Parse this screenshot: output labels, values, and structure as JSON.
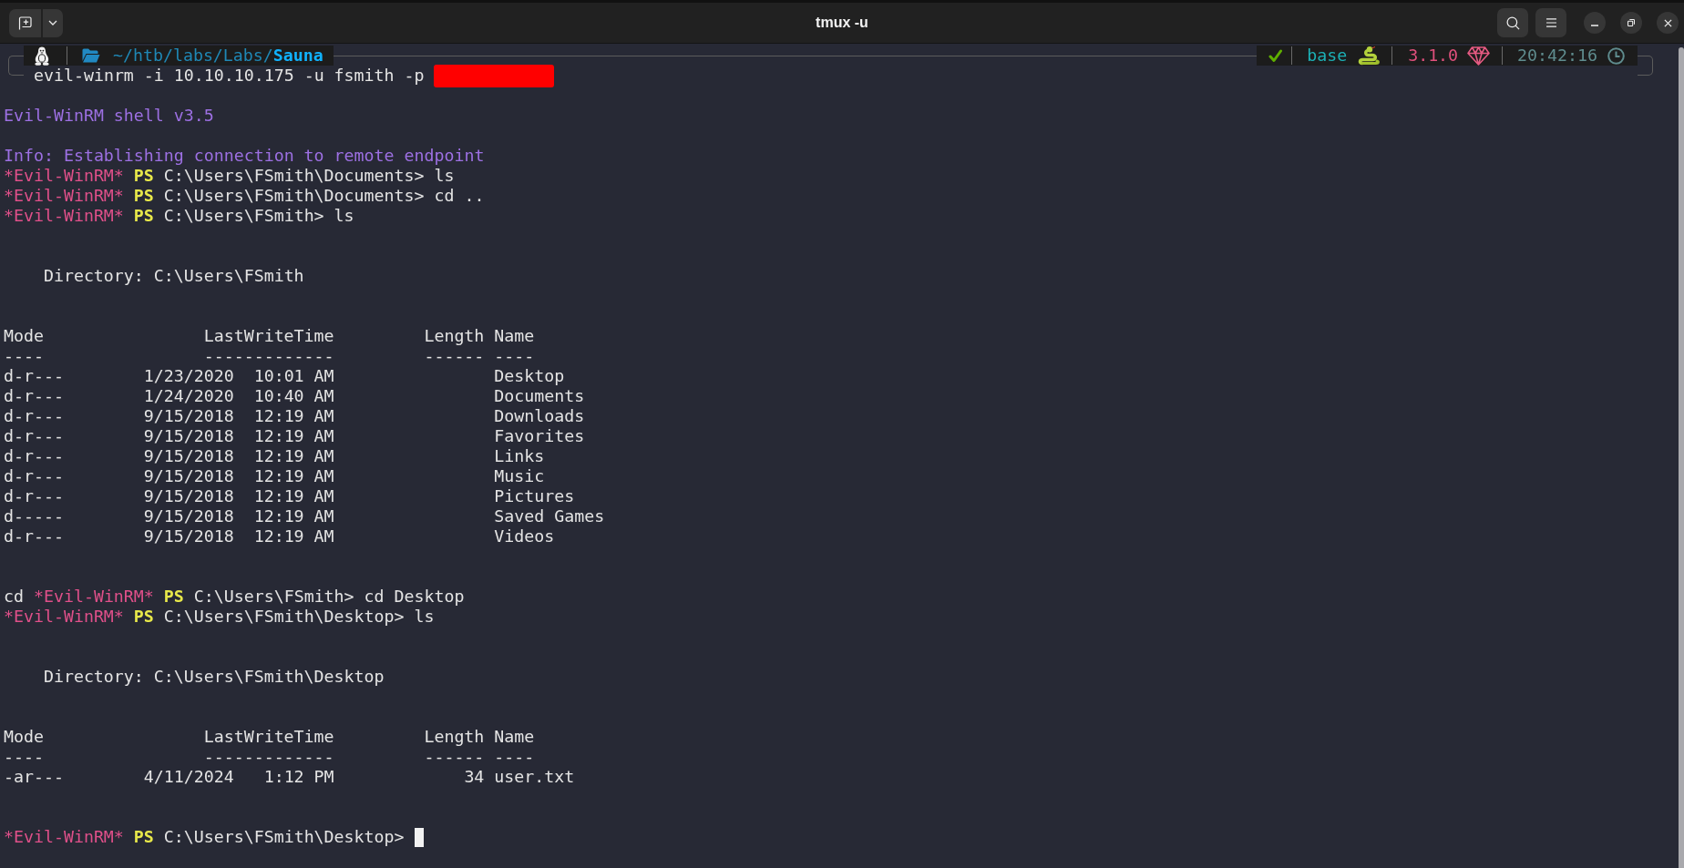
{
  "window": {
    "title": "tmux -u"
  },
  "prompt_bar": {
    "path_prefix": "~/htb/labs/Labs/",
    "path_current": "Sauna",
    "environment": "base",
    "ruby_version": "3.1.0",
    "time": "20:42:16"
  },
  "command_line": {
    "text": "evil-winrm -i 10.10.10.175 -u fsmith -p",
    "redacted": true
  },
  "output": [
    {
      "kind": "blank"
    },
    {
      "kind": "banner",
      "text": "Evil-WinRM shell v3.5"
    },
    {
      "kind": "blank"
    },
    {
      "kind": "info",
      "text": "Info: Establishing connection to remote endpoint"
    },
    {
      "kind": "prompt",
      "label": "*Evil-WinRM*",
      "shell": "PS",
      "path": "C:\\Users\\FSmith\\Documents>",
      "command": "ls",
      "cursor": false
    },
    {
      "kind": "prompt",
      "label": "*Evil-WinRM*",
      "shell": "PS",
      "path": "C:\\Users\\FSmith\\Documents>",
      "command": "cd ..",
      "cursor": false
    },
    {
      "kind": "prompt",
      "label": "*Evil-WinRM*",
      "shell": "PS",
      "path": "C:\\Users\\FSmith>",
      "command": "ls",
      "cursor": false
    },
    {
      "kind": "blank"
    },
    {
      "kind": "blank"
    },
    {
      "kind": "heading",
      "text": "Directory: C:\\Users\\FSmith"
    },
    {
      "kind": "blank"
    },
    {
      "kind": "blank"
    },
    {
      "kind": "table",
      "columns": [
        {
          "header": "Mode",
          "rule": "----"
        },
        {
          "header": "LastWriteTime",
          "rule": "-------------"
        },
        {
          "header": "Length",
          "rule": "------"
        },
        {
          "header": "Name",
          "rule": "----"
        }
      ],
      "rows": [
        {
          "mode": "d-r---",
          "last_write_time": "1/23/2020  10:01 AM",
          "name": "Desktop"
        },
        {
          "mode": "d-r---",
          "last_write_time": "1/24/2020  10:40 AM",
          "name": "Documents"
        },
        {
          "mode": "d-r---",
          "last_write_time": "9/15/2018  12:19 AM",
          "name": "Downloads"
        },
        {
          "mode": "d-r---",
          "last_write_time": "9/15/2018  12:19 AM",
          "name": "Favorites"
        },
        {
          "mode": "d-r---",
          "last_write_time": "9/15/2018  12:19 AM",
          "name": "Links"
        },
        {
          "mode": "d-r---",
          "last_write_time": "9/15/2018  12:19 AM",
          "name": "Music"
        },
        {
          "mode": "d-r---",
          "last_write_time": "9/15/2018  12:19 AM",
          "name": "Pictures"
        },
        {
          "mode": "d-----",
          "last_write_time": "9/15/2018  12:19 AM",
          "name": "Saved Games"
        },
        {
          "mode": "d-r---",
          "last_write_time": "9/15/2018  12:19 AM",
          "name": "Videos"
        }
      ]
    },
    {
      "kind": "blank"
    },
    {
      "kind": "blank"
    },
    {
      "kind": "prompt",
      "prefix": "cd",
      "label": "*Evil-WinRM*",
      "shell": "PS",
      "path": "C:\\Users\\FSmith>",
      "command": "cd Desktop",
      "cursor": false
    },
    {
      "kind": "prompt",
      "label": "*Evil-WinRM*",
      "shell": "PS",
      "path": "C:\\Users\\FSmith\\Desktop>",
      "command": "ls",
      "cursor": false
    },
    {
      "kind": "blank"
    },
    {
      "kind": "blank"
    },
    {
      "kind": "heading",
      "text": "Directory: C:\\Users\\FSmith\\Desktop"
    },
    {
      "kind": "blank"
    },
    {
      "kind": "blank"
    },
    {
      "kind": "table",
      "columns": [
        {
          "header": "Mode",
          "rule": "----"
        },
        {
          "header": "LastWriteTime",
          "rule": "-------------"
        },
        {
          "header": "Length",
          "rule": "------"
        },
        {
          "header": "Name",
          "rule": "----"
        }
      ],
      "rows": [
        {
          "mode": "-ar---",
          "last_write_time": "4/11/2024   1:12 PM",
          "length": "34",
          "name": "user.txt"
        }
      ]
    },
    {
      "kind": "blank"
    },
    {
      "kind": "blank"
    },
    {
      "kind": "prompt",
      "label": "*Evil-WinRM*",
      "shell": "PS",
      "path": "C:\\Users\\FSmith\\Desktop>",
      "cursor": true
    }
  ]
}
